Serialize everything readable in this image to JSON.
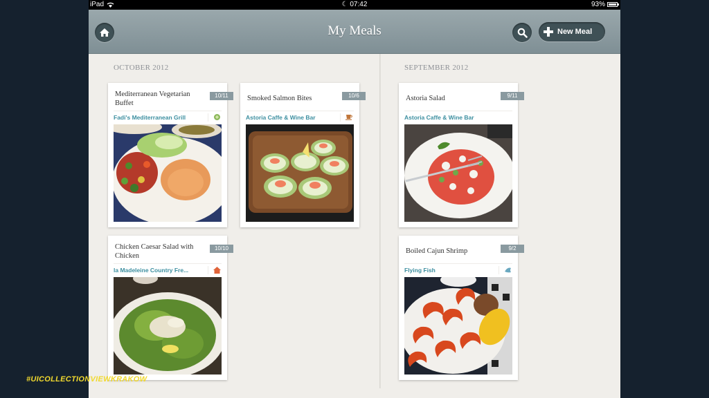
{
  "status_bar": {
    "device": "iPad",
    "time": "07:42",
    "battery": "93%"
  },
  "nav": {
    "title": "My Meals",
    "new_meal_label": "New Meal"
  },
  "sections": [
    {
      "header": "OCTOBER 2012"
    },
    {
      "header": "SEPTEMBER 2012"
    }
  ],
  "cards": [
    {
      "title": "Mediterranean Vegetarian Buffet",
      "date": "10/11",
      "place": "Fadi's Mediterranean Grill",
      "place_icon": "plate-icon",
      "photo": "mediterranean-platter"
    },
    {
      "title": "Smoked Salmon Bites",
      "date": "10/6",
      "place": "Astoria Caffe & Wine Bar",
      "place_icon": "coffee-cup-icon",
      "photo": "salmon-cucumber-bites"
    },
    {
      "title": "Chicken Caesar Salad with Chicken",
      "date": "10/10",
      "place": "la Madeleine Country Fre...",
      "place_icon": "house-icon",
      "photo": "caesar-salad"
    },
    {
      "title": "Astoria Salad",
      "date": "9/11",
      "place": "Astoria Caffe & Wine Bar",
      "place_icon": "",
      "photo": "astoria-salad"
    },
    {
      "title": "Boiled Cajun Shrimp",
      "date": "9/2",
      "place": "Flying Fish",
      "place_icon": "fish-icon",
      "photo": "cajun-shrimp-boil"
    }
  ],
  "watermark": "#UICOLLECTIONVIEWKRAKOW",
  "colors": {
    "accent_link": "#3d8fa0",
    "navbar": "#8a9aa0",
    "watermark": "#f1d92e"
  }
}
